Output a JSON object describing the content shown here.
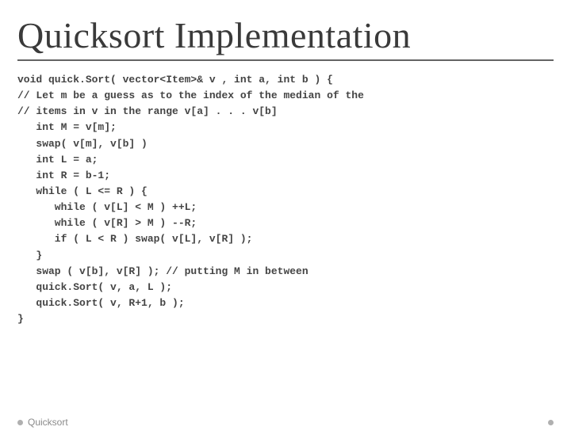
{
  "title": "Quicksort Implementation",
  "code_lines": [
    "void quick.Sort( vector<Item>& v , int a, int b ) {",
    "// Let m be a guess as to the index of the median of the",
    "// items in v in the range v[a] . . . v[b]",
    "   int M = v[m];",
    "   swap( v[m], v[b] )",
    "   int L = a;",
    "   int R = b-1;",
    "   while ( L <= R ) {",
    "      while ( v[L] < M ) ++L;",
    "      while ( v[R] > M ) --R;",
    "      if ( L < R ) swap( v[L], v[R] );",
    "   }",
    "   swap ( v[b], v[R] ); // putting M in between",
    "   quick.Sort( v, a, L );",
    "   quick.Sort( v, R+1, b );",
    "}"
  ],
  "footer_text": "Quicksort"
}
